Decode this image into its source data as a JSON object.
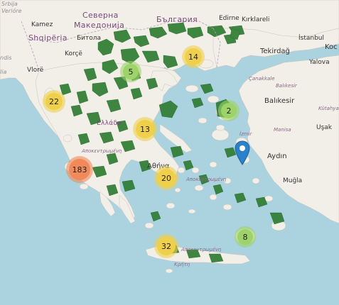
{
  "map": {
    "labels": {
      "serbia": "Srbija",
      "veriore": "Verióre",
      "north_macedonia_1": "Северна",
      "north_macedonia_2": "Македонија",
      "bulgaria": "България",
      "edirne": "Edirne",
      "kirklareli": "Kırklareli",
      "kamez": "Kamez",
      "bitola": "Битола",
      "shqiperia": "Shqipëria",
      "istanbul": "İstanbul",
      "tekirdag": "Tekirdağ",
      "koc": "Koc",
      "korce": "Korçë",
      "vlore": "Vlorë",
      "yalova": "Yalova",
      "canakkale": "Çanakkale",
      "balikesir_region": "Balıkesir",
      "balikesir": "Balıkesir",
      "kutahya": "Kütahya",
      "izmir": "İzmir",
      "manisa": "Manisa",
      "usak": "Uşak",
      "aydin": "Aydın",
      "mugla": "Muğla",
      "athens": "Αθήνα",
      "ellada": "Ελλάδα",
      "kriti": "Κρήτη",
      "apokentrosi": "Αποκεντρωμένη",
      "left_frag": "ndis",
      "left_frag2": "lia"
    },
    "clusters": [
      {
        "count": "5",
        "color": "green"
      },
      {
        "count": "14",
        "color": "yellow"
      },
      {
        "count": "22",
        "color": "yellow"
      },
      {
        "count": "2",
        "color": "green"
      },
      {
        "count": "13",
        "color": "yellow"
      },
      {
        "count": "183",
        "color": "orange"
      },
      {
        "count": "20",
        "color": "yellow"
      },
      {
        "count": "8",
        "color": "green"
      },
      {
        "count": "32",
        "color": "yellow"
      }
    ],
    "marker": "map-marker-icon",
    "colors": {
      "water": "#aad3df",
      "land": "#f2efe9",
      "protected_area": "#2f7d32",
      "cluster_green": "#9ed36a",
      "cluster_yellow": "#f0d04a",
      "cluster_orange": "#f08a5a",
      "marker": "#2b82cb"
    }
  }
}
